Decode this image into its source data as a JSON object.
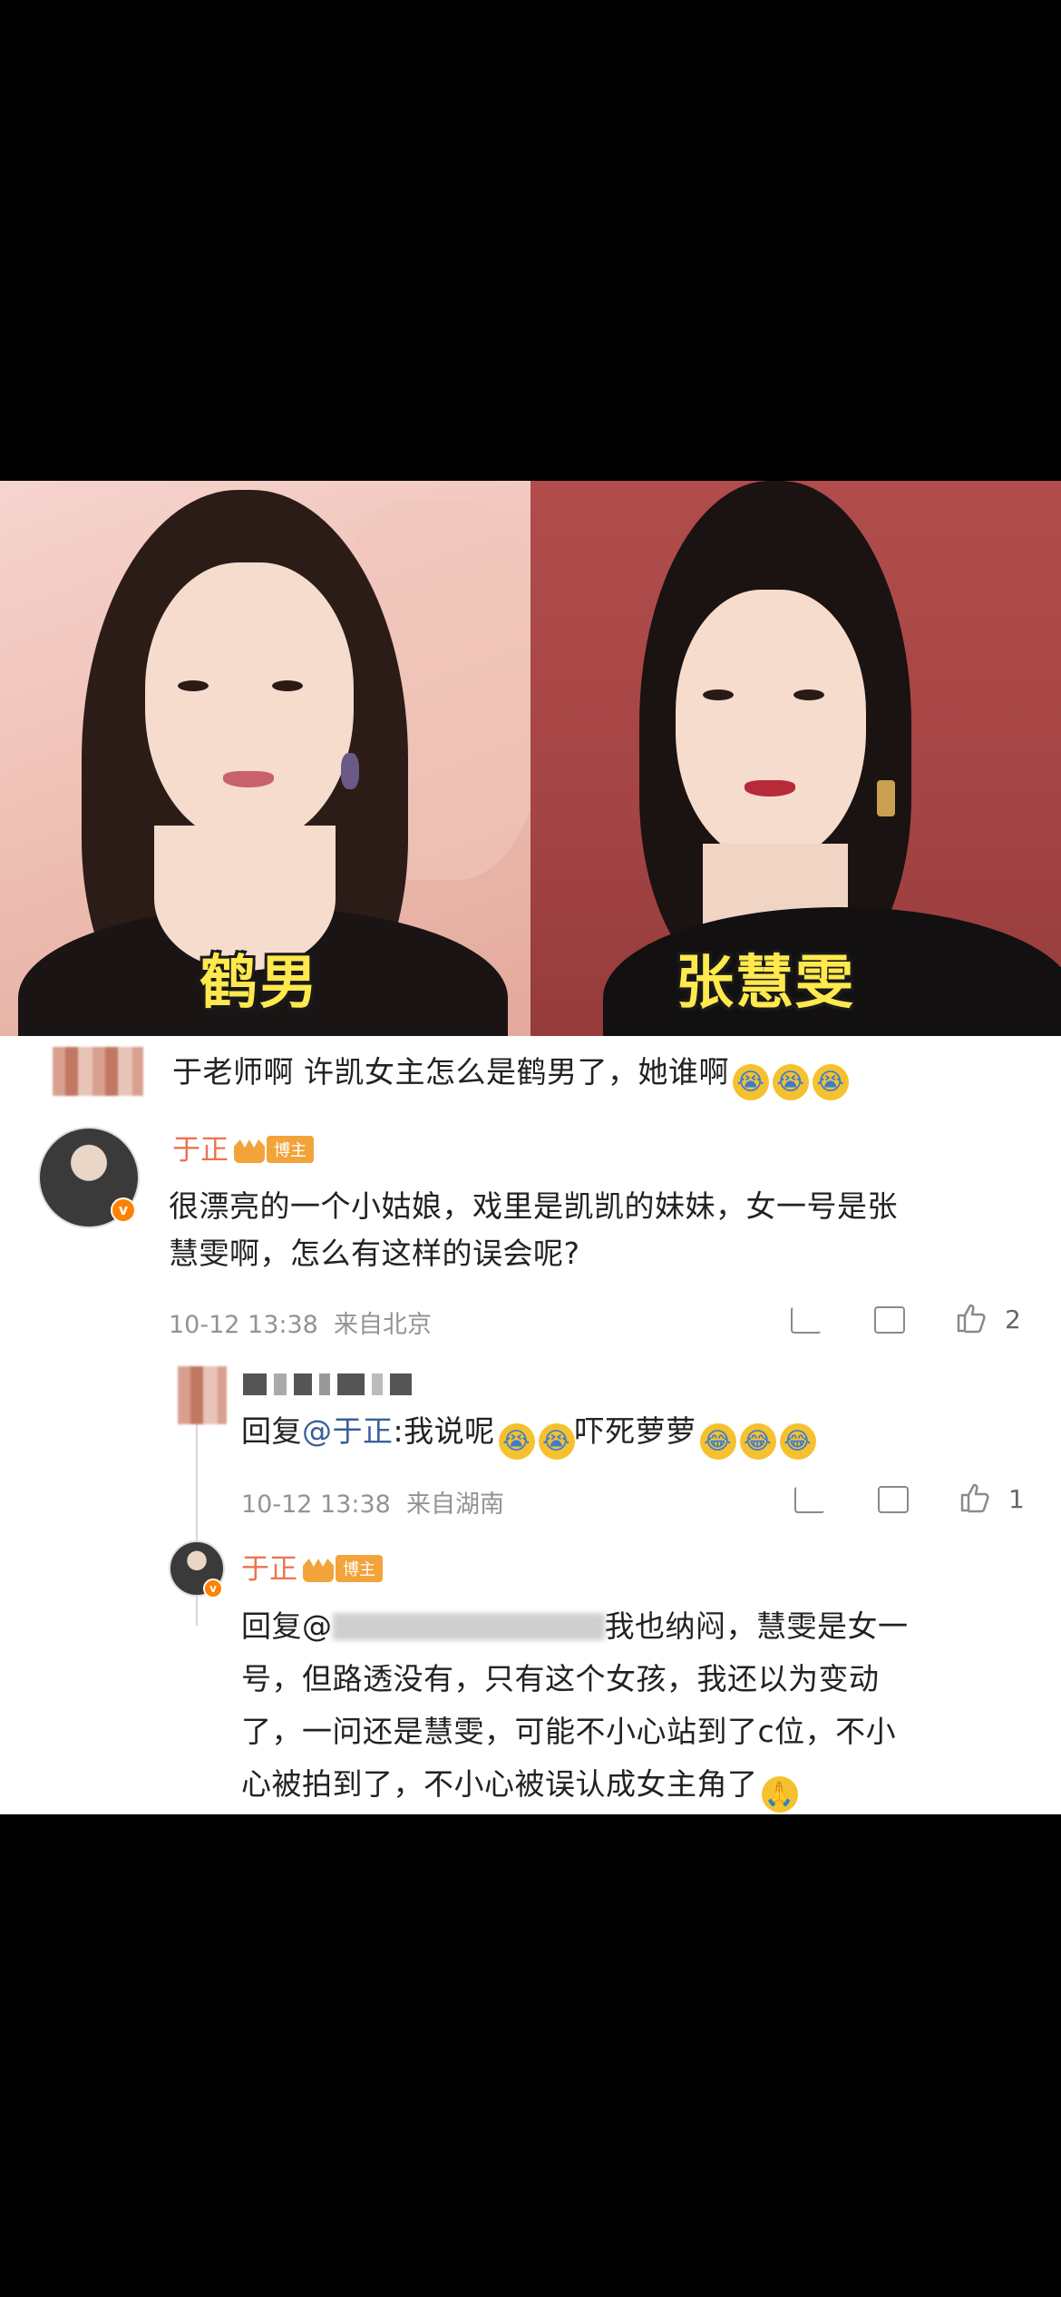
{
  "photos": {
    "left_caption": "鹤男",
    "right_caption": "张慧雯"
  },
  "comments": {
    "top_comment": {
      "text": "于老师啊 许凯女主怎么是鹤男了，她谁啊"
    },
    "main_reply": {
      "username": "于正",
      "badge": "博主",
      "verified_mark": "v",
      "text_line1": "很漂亮的一个小姑娘，戏里是凯凯的妹妹，女一号是张",
      "text_line2": "慧雯啊，怎么有这样的误会呢?",
      "timestamp": "10-12 13:38",
      "location": "来自北京",
      "like_count": "2"
    },
    "sub_reply_1": {
      "text_prefix": "回复",
      "mention": "@于正",
      "text_a": ":我说呢",
      "text_b": "吓死萝萝",
      "timestamp": "10-12 13:38",
      "location": "来自湖南",
      "like_count": "1"
    },
    "sub_reply_2": {
      "username": "于正",
      "badge": "博主",
      "text_prefix": "回复@",
      "line1_tail": "我也纳闷，慧雯是女一",
      "line2": "号，但路透没有，只有这个女孩，我还以为变动",
      "line3": "了，一问还是慧雯，可能不小心站到了c位，不小",
      "line4": "心被拍到了，不小心被误认成女主角了"
    },
    "emoji": {
      "crying": "😭",
      "laughing_crying": "😂",
      "pray": "🙏"
    }
  }
}
